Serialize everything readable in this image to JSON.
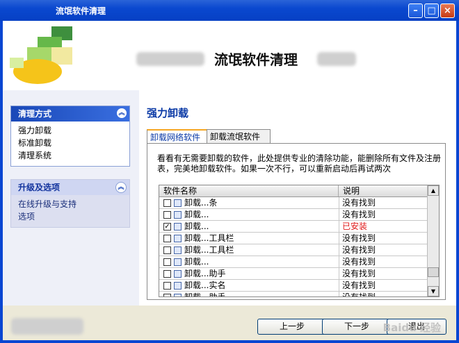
{
  "window": {
    "title": "流氓软件清理"
  },
  "header": {
    "title": "流氓软件清理"
  },
  "sidebar": {
    "sections": [
      {
        "title": "清理方式",
        "items": [
          "强力卸载",
          "标准卸载",
          "清理系统"
        ]
      },
      {
        "title": "升级及选项",
        "items": [
          "在线升级与支持",
          "选项"
        ]
      }
    ]
  },
  "main": {
    "title": "强力卸载",
    "tabs": [
      "卸载网络软件",
      "卸载流氓软件"
    ],
    "description": "看看有无需要卸载的软件，此处提供专业的清除功能，能删除所有文件及注册表，完美地卸载软件。如果一次不行，可以重新启动后再试两次",
    "table": {
      "columns": [
        "软件名称",
        "说明"
      ],
      "rows": [
        {
          "name": "卸载...条",
          "status": "没有找到",
          "checked": false,
          "status_color": "#000000"
        },
        {
          "name": "卸载...",
          "status": "没有找到",
          "checked": false,
          "status_color": "#000000"
        },
        {
          "name": "卸载...",
          "status": "已安装",
          "checked": true,
          "status_color": "#e01919"
        },
        {
          "name": "卸载...工具栏",
          "status": "没有找到",
          "checked": false,
          "status_color": "#000000"
        },
        {
          "name": "卸载...工具栏",
          "status": "没有找到",
          "checked": false,
          "status_color": "#000000"
        },
        {
          "name": "卸载...",
          "status": "没有找到",
          "checked": false,
          "status_color": "#000000"
        },
        {
          "name": "卸载...助手",
          "status": "没有找到",
          "checked": false,
          "status_color": "#000000"
        },
        {
          "name": "卸载...实名",
          "status": "没有找到",
          "checked": false,
          "status_color": "#000000"
        },
        {
          "name": "卸载...助手",
          "status": "没有找到",
          "checked": false,
          "status_color": "#000000"
        }
      ]
    }
  },
  "footer": {
    "prev": "上一步",
    "next": "下一步",
    "exit": "退出"
  },
  "watermark": "Baidu 经验",
  "colors": {
    "titlebar": "#0a48cf",
    "accent": "#0b3aa6",
    "installed": "#e01919"
  }
}
